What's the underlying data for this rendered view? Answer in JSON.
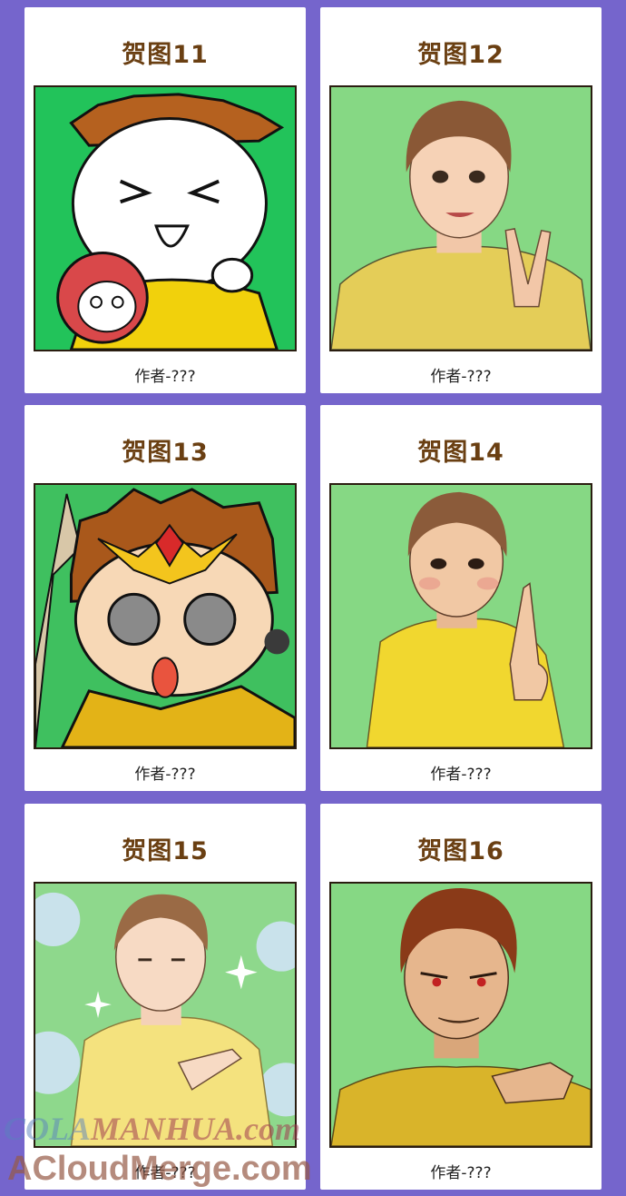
{
  "cards": [
    {
      "title": "贺图11",
      "author": "作者-???",
      "bg": "#22c35a"
    },
    {
      "title": "贺图12",
      "author": "作者-???",
      "bg": "#86d884"
    },
    {
      "title": "贺图13",
      "author": "作者-???",
      "bg": "#3fc05f"
    },
    {
      "title": "贺图14",
      "author": "作者-???",
      "bg": "#86d884"
    },
    {
      "title": "贺图15",
      "author": "作者-???",
      "bg": "#8ed88c"
    },
    {
      "title": "贺图16",
      "author": "作者-???",
      "bg": "#86d884"
    }
  ],
  "watermark": {
    "line1_a": "COLA",
    "line1_b": "MANHUA.com",
    "line2": "ACloudMerge.com"
  }
}
